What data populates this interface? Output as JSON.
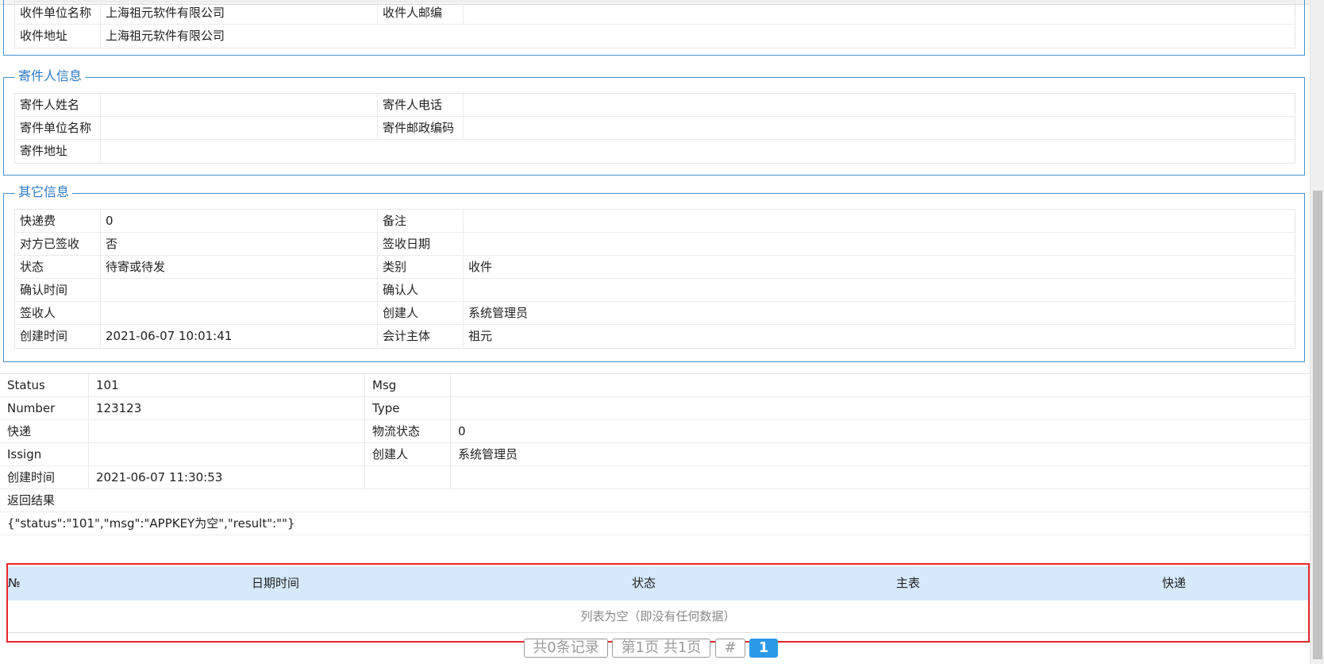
{
  "recipient": {
    "rows": [
      {
        "label1": "收件单位名称",
        "value1": "上海祖元软件有限公司",
        "label2": "收件人邮编",
        "value2": ""
      },
      {
        "label1": "收件地址",
        "value1": "上海祖元软件有限公司",
        "label2": "",
        "value2": ""
      }
    ]
  },
  "sender": {
    "legend": "寄件人信息",
    "rows": [
      {
        "label1": "寄件人姓名",
        "value1": "",
        "label2": "寄件人电话",
        "value2": ""
      },
      {
        "label1": "寄件单位名称",
        "value1": "",
        "label2": "寄件邮政编码",
        "value2": ""
      },
      {
        "label1": "寄件地址",
        "value1": "",
        "label2": "",
        "value2": ""
      }
    ]
  },
  "other": {
    "legend": "其它信息",
    "rows": [
      {
        "label1": "快递费",
        "value1": "0",
        "label2": "备注",
        "value2": ""
      },
      {
        "label1": "对方已签收",
        "value1": "否",
        "label2": "签收日期",
        "value2": ""
      },
      {
        "label1": "状态",
        "value1": "待寄或待发",
        "label2": "类别",
        "value2": "收件"
      },
      {
        "label1": "确认时间",
        "value1": "",
        "label2": "确认人",
        "value2": ""
      },
      {
        "label1": "签收人",
        "value1": "",
        "label2": "创建人",
        "value2": "系统管理员"
      },
      {
        "label1": "创建时间",
        "value1": "2021-06-07 10:01:41",
        "label2": "会计主体",
        "value2": "祖元"
      }
    ]
  },
  "result": {
    "rows": [
      {
        "label1": "Status",
        "value1": "101",
        "label2": "Msg",
        "value2": ""
      },
      {
        "label1": "Number",
        "value1": "123123",
        "label2": "Type",
        "value2": ""
      },
      {
        "label1": "快递",
        "value1": "",
        "label2": "物流状态",
        "value2": "0"
      },
      {
        "label1": "Issign",
        "value1": "",
        "label2": "创建人",
        "value2": "系统管理员"
      },
      {
        "label1": "创建时间",
        "value1": "2021-06-07 11:30:53",
        "label2": "",
        "value2": ""
      }
    ],
    "return_label": "返回结果",
    "return_value": "{\"status\":\"101\",\"msg\":\"APPKEY为空\",\"result\":\"\"}"
  },
  "list": {
    "columns": [
      "№",
      "日期时间",
      "状态",
      "主表",
      "快递"
    ],
    "empty_text": "列表为空（即没有任何数据）"
  },
  "pager": {
    "total": "共0条记录",
    "page_info": "第1页 共1页",
    "jump": "#",
    "current": "1"
  },
  "colors": {
    "accent": "#2d7ac4",
    "header_bg": "#d5e9fb",
    "highlight_border": "#e8262c",
    "pager_current": "#2b9be8"
  }
}
